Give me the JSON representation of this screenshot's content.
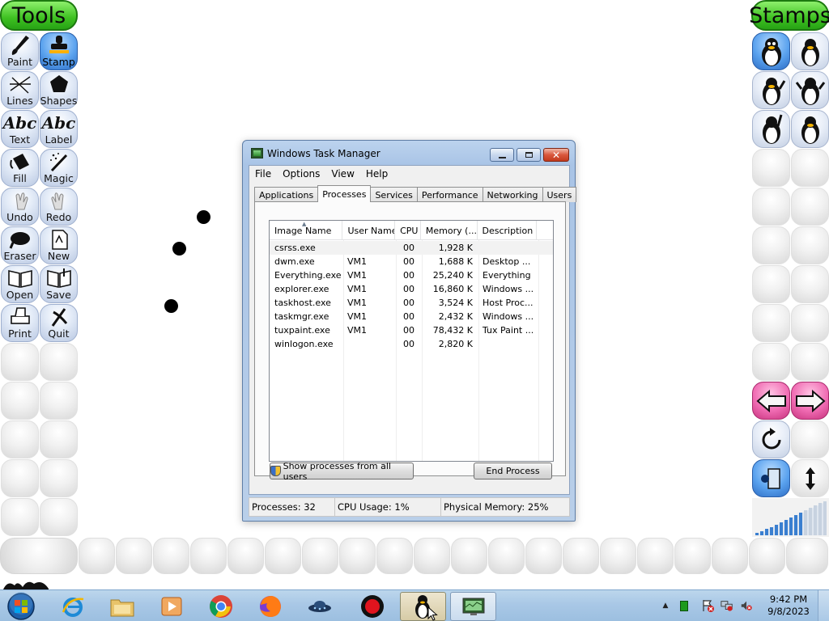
{
  "tuxpaint": {
    "tools_title": "Tools",
    "stamps_title": "Stamps",
    "tools": [
      {
        "label": "Paint",
        "icon": "paintbrush-icon"
      },
      {
        "label": "Stamp",
        "icon": "stamp-icon"
      },
      {
        "label": "Lines",
        "icon": "lines-icon"
      },
      {
        "label": "Shapes",
        "icon": "pentagon-icon"
      },
      {
        "label": "Text",
        "icon": "text-abc-icon"
      },
      {
        "label": "Label",
        "icon": "label-abc-icon"
      },
      {
        "label": "Fill",
        "icon": "paint-bucket-icon"
      },
      {
        "label": "Magic",
        "icon": "magic-wand-icon"
      },
      {
        "label": "Undo",
        "icon": "undo-hand-icon"
      },
      {
        "label": "Redo",
        "icon": "redo-hand-icon"
      },
      {
        "label": "Eraser",
        "icon": "eraser-icon"
      },
      {
        "label": "New",
        "icon": "new-page-icon"
      },
      {
        "label": "Open",
        "icon": "open-book-icon"
      },
      {
        "label": "Save",
        "icon": "save-book-icon"
      },
      {
        "label": "Print",
        "icon": "printer-icon"
      },
      {
        "label": "Quit",
        "icon": "quit-x-icon"
      }
    ],
    "text_icon_glyph": "Abc",
    "label_icon_glyph": "Abc",
    "active_tool": "Stamp",
    "accent_green": "#3ec021",
    "accent_blue": "#5aa2ee",
    "accent_pink": "#f06cb3"
  },
  "taskmgr": {
    "title": "Windows Task Manager",
    "menu": [
      "File",
      "Options",
      "View",
      "Help"
    ],
    "tabs": [
      "Applications",
      "Processes",
      "Services",
      "Performance",
      "Networking",
      "Users"
    ],
    "selected_tab": "Processes",
    "columns": [
      "Image Name",
      "User Name",
      "CPU",
      "Memory (...",
      "Description"
    ],
    "processes": [
      {
        "name": "csrss.exe",
        "user": "",
        "cpu": "00",
        "mem": "1,928 K",
        "desc": ""
      },
      {
        "name": "dwm.exe",
        "user": "VM1",
        "cpu": "00",
        "mem": "1,688 K",
        "desc": "Desktop ..."
      },
      {
        "name": "Everything.exe",
        "user": "VM1",
        "cpu": "00",
        "mem": "25,240 K",
        "desc": "Everything"
      },
      {
        "name": "explorer.exe",
        "user": "VM1",
        "cpu": "00",
        "mem": "16,860 K",
        "desc": "Windows ..."
      },
      {
        "name": "taskhost.exe",
        "user": "VM1",
        "cpu": "00",
        "mem": "3,524 K",
        "desc": "Host Proc..."
      },
      {
        "name": "taskmgr.exe",
        "user": "VM1",
        "cpu": "00",
        "mem": "2,432 K",
        "desc": "Windows ..."
      },
      {
        "name": "tuxpaint.exe",
        "user": "VM1",
        "cpu": "00",
        "mem": "78,432 K",
        "desc": "Tux Paint ..."
      },
      {
        "name": "winlogon.exe",
        "user": "",
        "cpu": "00",
        "mem": "2,820 K",
        "desc": ""
      }
    ],
    "show_all_label": "Show processes from all users",
    "end_process_label": "End Process",
    "status": {
      "processes": "Processes: 32",
      "cpu": "CPU Usage: 1%",
      "memory": "Physical Memory: 25%"
    }
  },
  "taskbar": {
    "time": "9:42 PM",
    "date": "9/8/2023",
    "apps": [
      "internet-explorer-icon",
      "file-explorer-icon",
      "media-player-icon",
      "chrome-icon",
      "firefox-icon",
      "ufo-app-icon",
      "record-icon",
      "tuxpaint-icon",
      "task-manager-icon"
    ]
  }
}
